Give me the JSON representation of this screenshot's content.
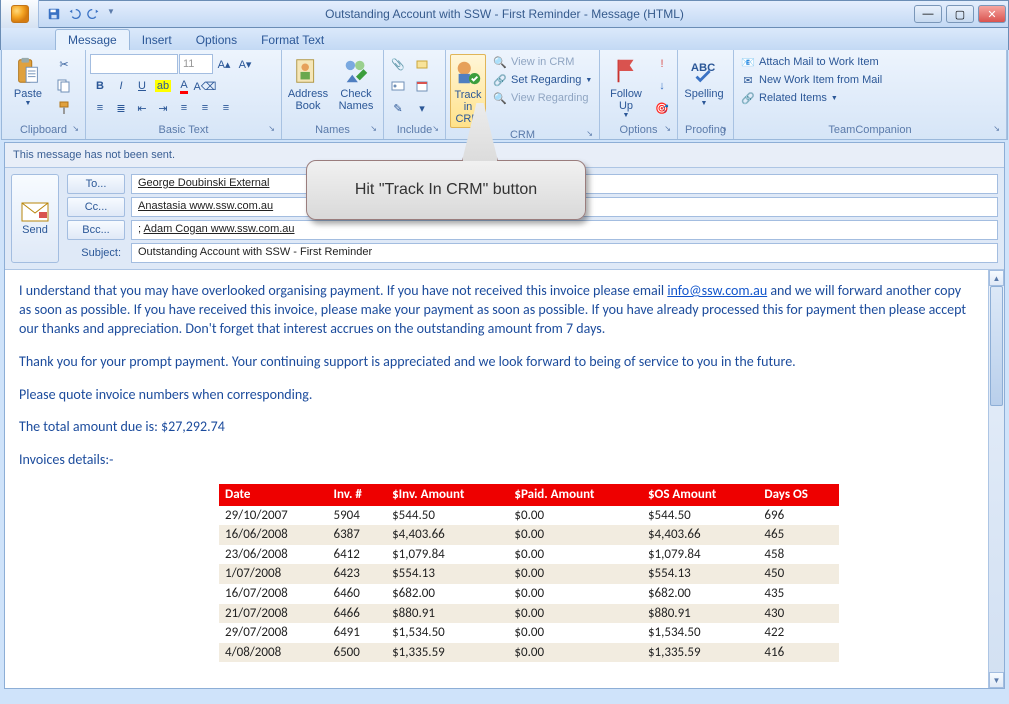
{
  "window": {
    "title": "Outstanding Account with SSW - First Reminder - Message (HTML)"
  },
  "tabs": {
    "message": "Message",
    "insert": "Insert",
    "options": "Options",
    "formattext": "Format Text"
  },
  "ribbon": {
    "clipboard": {
      "paste": "Paste",
      "label": "Clipboard"
    },
    "basictext": {
      "label": "Basic Text",
      "fontsize": "11"
    },
    "names": {
      "address": "Address Book",
      "check": "Check Names",
      "label": "Names"
    },
    "include": {
      "label": "Include"
    },
    "crm": {
      "track": "Track in CRM",
      "view": "View in CRM",
      "setreg": "Set Regarding",
      "viewreg": "View Regarding",
      "label": "CRM"
    },
    "followup": {
      "follow": "Follow Up",
      "label": "Options"
    },
    "proofing": {
      "spelling": "Spelling",
      "label": "Proofing"
    },
    "team": {
      "attach": "Attach Mail to Work Item",
      "newwork": "New Work Item from Mail",
      "related": "Related Items",
      "label": "TeamCompanion"
    }
  },
  "notsent": "This message has not been sent.",
  "send": "Send",
  "hdr": {
    "to_btn": "To...",
    "cc_btn": "Cc...",
    "bcc_btn": "Bcc...",
    "to_val": "George Doubinski External",
    "cc_val": "Anastasia www.ssw.com.au",
    "bcc_val_prefix": "; ",
    "bcc_val": "Adam Cogan www.ssw.com.au",
    "subject_lbl": "Subject:",
    "subject_val": "Outstanding Account with SSW - First Reminder"
  },
  "body": {
    "p1a": "I understand that you may have overlooked organising payment. If you have not received this invoice please email ",
    "p1_link": "info@ssw.com.au",
    "p1b": " and we will forward another copy as soon as possible. If you have received this invoice, please make your payment as soon as possible. If you have already processed this for payment then please accept our thanks and appreciation. Don't forget that interest accrues on the outstanding amount from 7 days.",
    "p2": "Thank you for your prompt payment. Your continuing support is appreciated and we look forward to being of service to you in the future.",
    "p3": "Please quote invoice numbers when corresponding.",
    "p4": "The total amount due is: $27,292.74",
    "p5": "Invoices details:-"
  },
  "table": {
    "headers": [
      "Date",
      "Inv. #",
      "$Inv. Amount",
      "$Paid. Amount",
      "$OS Amount",
      "Days OS"
    ],
    "rows": [
      [
        "29/10/2007",
        "5904",
        "$544.50",
        "$0.00",
        "$544.50",
        "696"
      ],
      [
        "16/06/2008",
        "6387",
        "$4,403.66",
        "$0.00",
        "$4,403.66",
        "465"
      ],
      [
        "23/06/2008",
        "6412",
        "$1,079.84",
        "$0.00",
        "$1,079.84",
        "458"
      ],
      [
        "1/07/2008",
        "6423",
        "$554.13",
        "$0.00",
        "$554.13",
        "450"
      ],
      [
        "16/07/2008",
        "6460",
        "$682.00",
        "$0.00",
        "$682.00",
        "435"
      ],
      [
        "21/07/2008",
        "6466",
        "$880.91",
        "$0.00",
        "$880.91",
        "430"
      ],
      [
        "29/07/2008",
        "6491",
        "$1,534.50",
        "$0.00",
        "$1,534.50",
        "422"
      ],
      [
        "4/08/2008",
        "6500",
        "$1,335.59",
        "$0.00",
        "$1,335.59",
        "416"
      ]
    ]
  },
  "callout": "Hit \"Track In CRM\" button"
}
